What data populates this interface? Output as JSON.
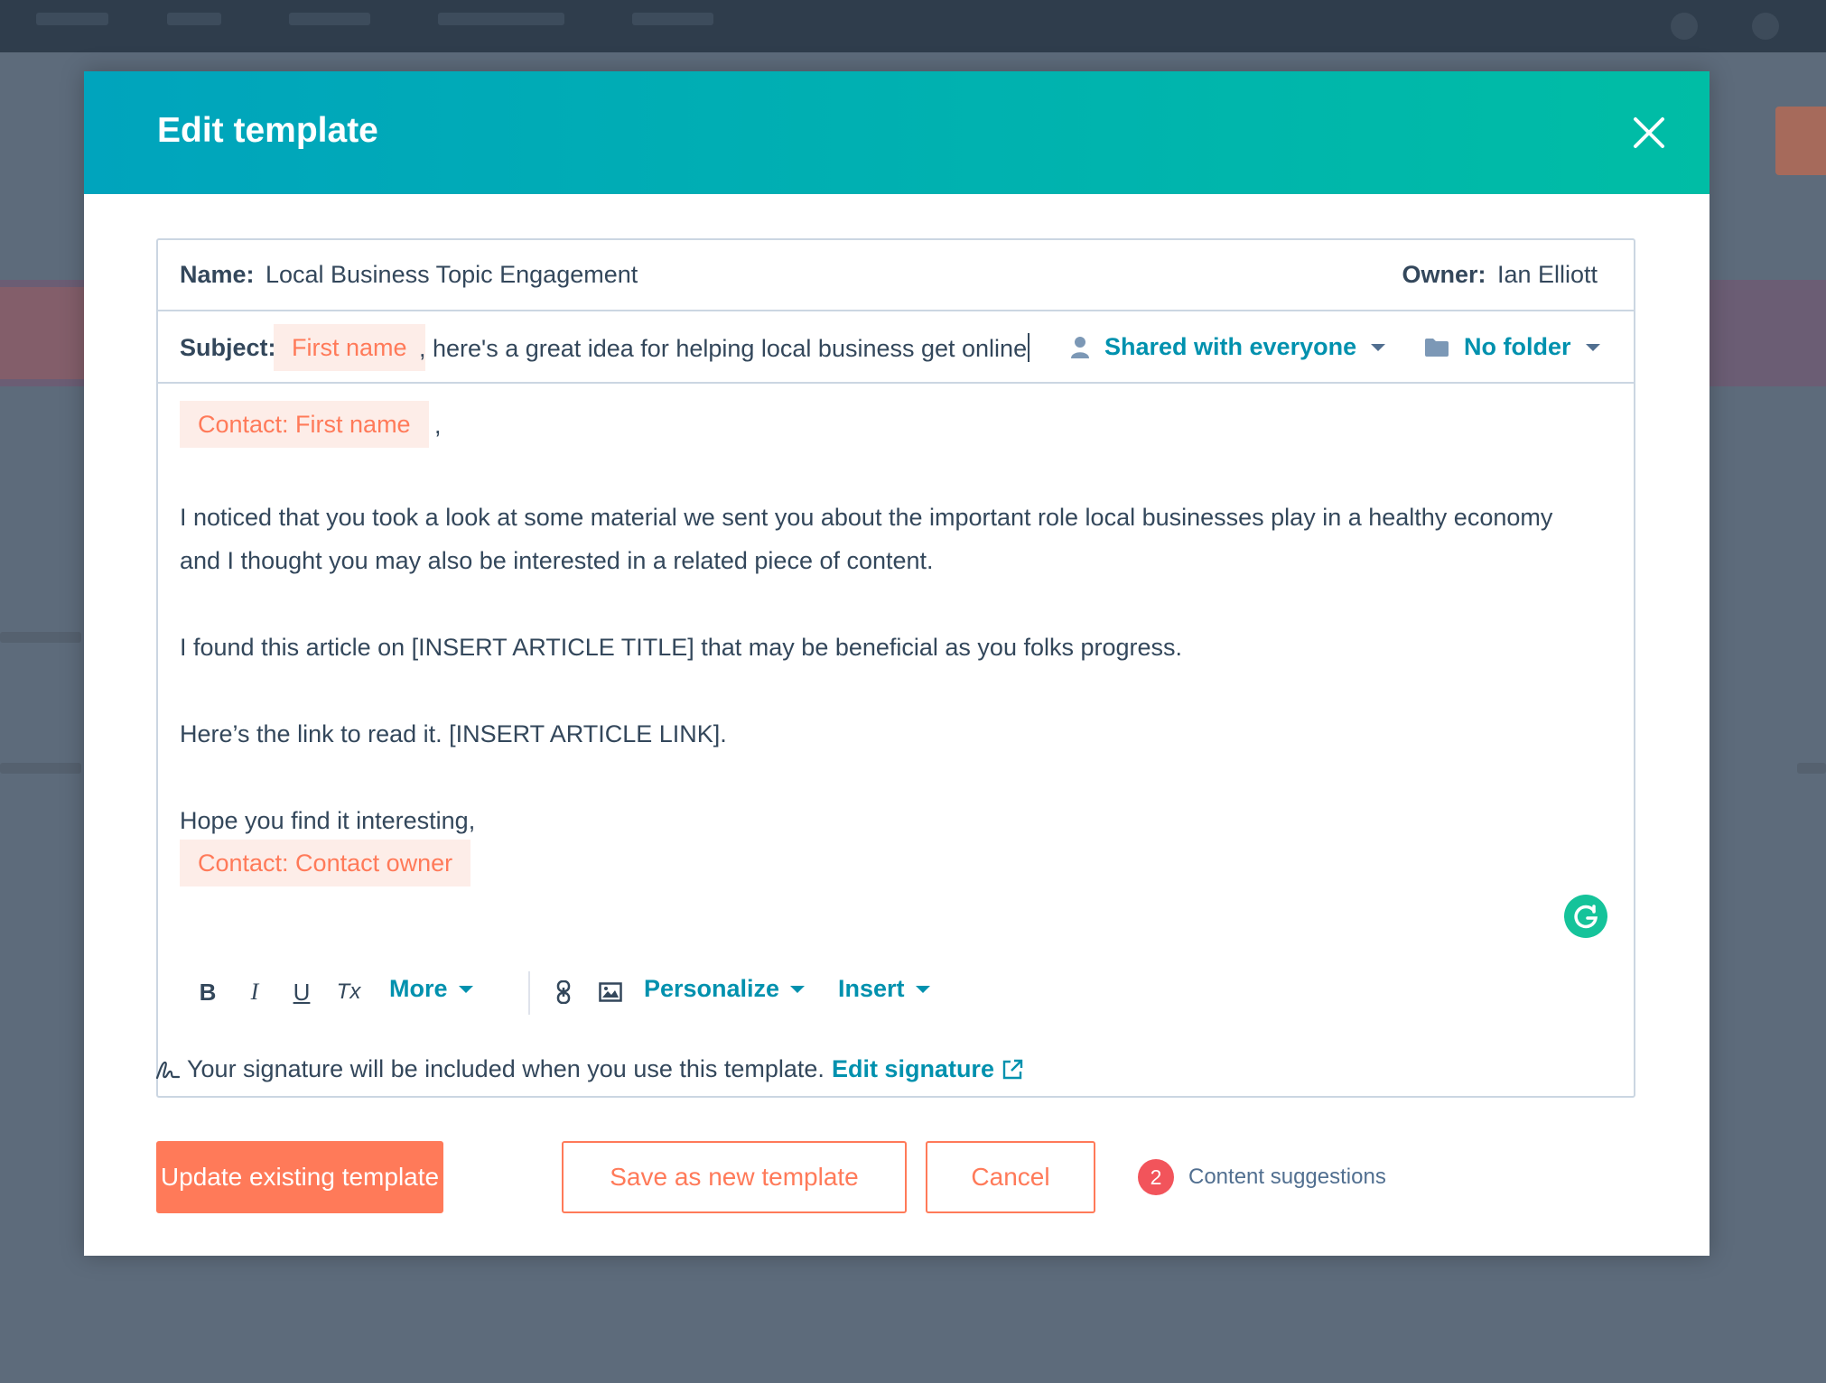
{
  "modal": {
    "title": "Edit template",
    "close_icon": "close-icon"
  },
  "template": {
    "name_label": "Name:",
    "name_value": "Local Business Topic Engagement",
    "owner_label": "Owner:",
    "owner_value": "Ian Elliott",
    "subject_label": "Subject:",
    "subject_token": "First name",
    "subject_text": ", here's a great idea for helping local business get online",
    "sharing": "Shared with everyone",
    "folder": "No folder"
  },
  "body": {
    "greeting_token": "Contact: First name",
    "greeting_suffix": ",",
    "line1": "I noticed that you took a look at some material we sent you about the important role local businesses play in a healthy economy",
    "line2": "and I thought you may also be interested in a related piece of content.",
    "line3": "I found this article on [INSERT ARTICLE TITLE] that may be beneficial as you folks progress.",
    "line4": "Here’s the link to read it. [INSERT ARTICLE LINK].",
    "closing": "Hope you find it interesting,",
    "owner_token": "Contact: Contact owner"
  },
  "toolbar": {
    "bold": "B",
    "italic": "I",
    "underline": "U",
    "clear_format": "Tx",
    "more": "More",
    "personalize": "Personalize",
    "insert": "Insert"
  },
  "signature": {
    "text": "Your signature will be included when you use this template.",
    "link": "Edit signature"
  },
  "footer": {
    "update": "Update existing template",
    "save_new": "Save as new template",
    "cancel": "Cancel",
    "suggestions_count": "2",
    "suggestions_label": "Content suggestions"
  },
  "colors": {
    "header_start": "#00a4bd",
    "header_end": "#00bda5",
    "accent_orange": "#ff7a59",
    "link_teal": "#0091ae",
    "text_dark": "#33475b",
    "badge_red": "#f2545b",
    "grammarly_green": "#15c39a"
  }
}
